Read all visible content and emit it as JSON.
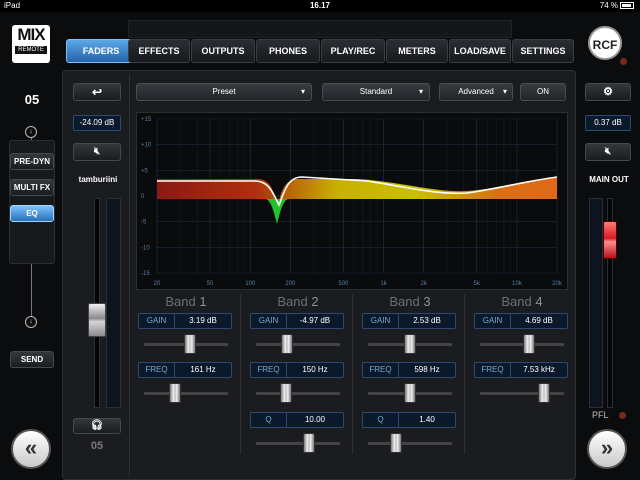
{
  "status": {
    "device": "iPad",
    "time": "16.17",
    "battery": "74 %"
  },
  "logo": {
    "line1": "MIX",
    "line2": "REMOTE"
  },
  "brand": "RCF",
  "tabs": [
    "FADERS",
    "EFFECTS",
    "OUTPUTS",
    "PHONES",
    "PLAY/REC",
    "METERS",
    "LOAD/SAVE",
    "SETTINGS"
  ],
  "active_tab": "FADERS",
  "left": {
    "channel": "05",
    "chain": [
      "PRE-DYN",
      "MULTI FX",
      "EQ"
    ],
    "active_chain": "EQ",
    "send": "SEND"
  },
  "strip": {
    "gain": "-24.09 dB",
    "name": "tamburiini",
    "number": "05",
    "fader_level": 0.42
  },
  "eq_toolbar": {
    "preset": "Preset",
    "type": "Standard",
    "mode": "Advanced",
    "on": "ON"
  },
  "graph": {
    "y_ticks": [
      "+15",
      "+10",
      "+5",
      "0",
      "-5",
      "-10",
      "-15"
    ],
    "x_ticks": [
      "20",
      "50",
      "100",
      "200",
      "500",
      "1k",
      "2k",
      "5k",
      "10k",
      "20k"
    ]
  },
  "bands": [
    {
      "title": "Band",
      "num": "1",
      "gain_label": "GAIN",
      "gain": "3.19 dB",
      "freq_label": "FREQ",
      "freq": "161 Hz",
      "gain_pos": 0.55,
      "freq_pos": 0.35
    },
    {
      "title": "Band",
      "num": "2",
      "gain_label": "GAIN",
      "gain": "-4.97 dB",
      "freq_label": "FREQ",
      "freq": "150 Hz",
      "q_label": "Q",
      "q": "10.00",
      "gain_pos": 0.35,
      "freq_pos": 0.33,
      "q_pos": 0.65
    },
    {
      "title": "Band",
      "num": "3",
      "gain_label": "GAIN",
      "gain": "2.53 dB",
      "freq_label": "FREQ",
      "freq": "598 Hz",
      "q_label": "Q",
      "q": "1.40",
      "gain_pos": 0.5,
      "freq_pos": 0.5,
      "q_pos": 0.3
    },
    {
      "title": "Band",
      "num": "4",
      "gain_label": "GAIN",
      "gain": "4.69 dB",
      "freq_label": "FREQ",
      "freq": "7.53 kHz",
      "gain_pos": 0.6,
      "freq_pos": 0.8
    }
  ],
  "right": {
    "gain": "0.37 dB",
    "label": "MAIN OUT",
    "pfl": "PFL",
    "fader_level": 0.8
  },
  "icons": {
    "back": "undo-arrow-icon",
    "mute": "speaker-mute-icon",
    "headphones": "headphones-icon",
    "settings": "gear-icon",
    "prev": "double-chevron-left-icon",
    "next": "double-chevron-right-icon"
  }
}
